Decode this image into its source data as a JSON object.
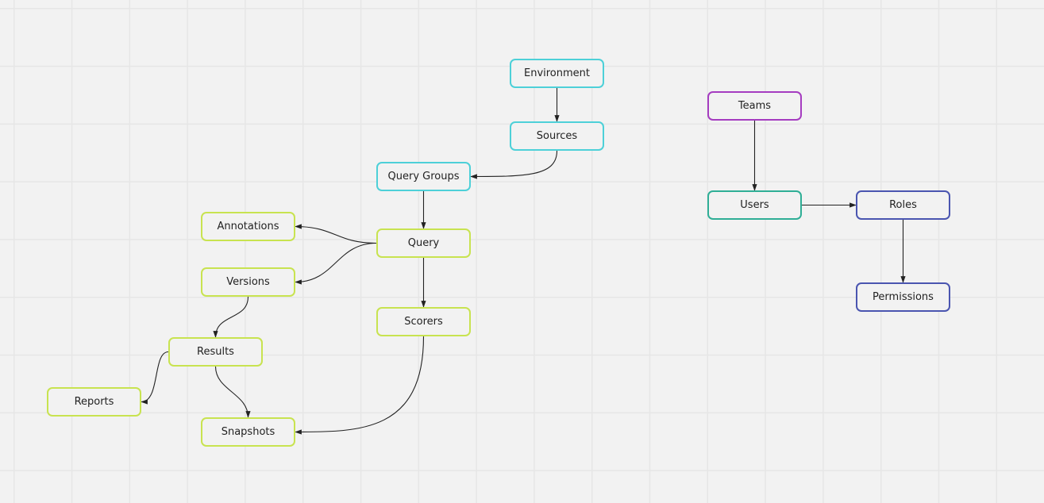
{
  "diagram": {
    "colors": {
      "cyan": "#4dd0d8",
      "lime": "#c8e350",
      "purple": "#a53cc0",
      "teal": "#2fae96",
      "indigo": "#4a55b0",
      "edge": "#222222",
      "background": "#f2f2f2",
      "grid": "#e6e6e6"
    },
    "nodes": [
      {
        "id": "environment",
        "label": "Environment",
        "color": "cyan"
      },
      {
        "id": "sources",
        "label": "Sources",
        "color": "cyan"
      },
      {
        "id": "query-groups",
        "label": "Query Groups",
        "color": "cyan"
      },
      {
        "id": "query",
        "label": "Query",
        "color": "lime"
      },
      {
        "id": "annotations",
        "label": "Annotations",
        "color": "lime"
      },
      {
        "id": "versions",
        "label": "Versions",
        "color": "lime"
      },
      {
        "id": "scorers",
        "label": "Scorers",
        "color": "lime"
      },
      {
        "id": "results",
        "label": "Results",
        "color": "lime"
      },
      {
        "id": "reports",
        "label": "Reports",
        "color": "lime"
      },
      {
        "id": "snapshots",
        "label": "Snapshots",
        "color": "lime"
      },
      {
        "id": "teams",
        "label": "Teams",
        "color": "purple"
      },
      {
        "id": "users",
        "label": "Users",
        "color": "teal"
      },
      {
        "id": "roles",
        "label": "Roles",
        "color": "indigo"
      },
      {
        "id": "permissions",
        "label": "Permissions",
        "color": "indigo"
      }
    ],
    "edges": [
      {
        "from": "environment",
        "to": "sources"
      },
      {
        "from": "sources",
        "to": "query-groups"
      },
      {
        "from": "query-groups",
        "to": "query"
      },
      {
        "from": "query",
        "to": "annotations"
      },
      {
        "from": "query",
        "to": "versions"
      },
      {
        "from": "query",
        "to": "scorers"
      },
      {
        "from": "versions",
        "to": "results"
      },
      {
        "from": "results",
        "to": "reports"
      },
      {
        "from": "results",
        "to": "snapshots"
      },
      {
        "from": "scorers",
        "to": "snapshots"
      },
      {
        "from": "teams",
        "to": "users"
      },
      {
        "from": "users",
        "to": "roles"
      },
      {
        "from": "roles",
        "to": "permissions"
      }
    ]
  }
}
